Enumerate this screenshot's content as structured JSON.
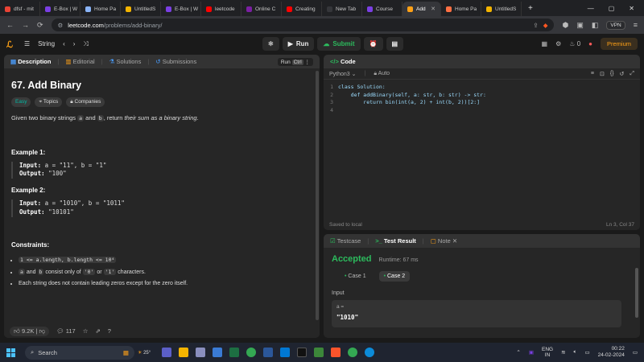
{
  "browser": {
    "tabs": [
      {
        "label": "dfsf - mit",
        "color": "#ea4335"
      },
      {
        "label": "E-Box | W",
        "color": "#7b3fe4"
      },
      {
        "label": "Home Pa",
        "color": "#8ab4f8"
      },
      {
        "label": "UntitledS",
        "color": "#f4b400"
      },
      {
        "label": "E-Box | W",
        "color": "#7b3fe4"
      },
      {
        "label": "leetcode",
        "color": "#ff0000"
      },
      {
        "label": "Online C",
        "color": "#7b1fa2"
      },
      {
        "label": "Creating",
        "color": "#ff0000"
      },
      {
        "label": "New Tab",
        "color": "#35363a"
      },
      {
        "label": "Course",
        "color": "#7b3fe4"
      },
      {
        "label": "Add",
        "color": "#ffa116",
        "active": true
      },
      {
        "label": "Home Pa",
        "color": "#ff7043"
      },
      {
        "label": "UntitledS",
        "color": "#f4b400"
      }
    ],
    "new_tab": "+",
    "url_host": "leetcode.com",
    "url_path": "/problems/add-binary/",
    "vpn": "VPN"
  },
  "lc_header": {
    "problem_list": "String",
    "run": "Run",
    "submit": "Submit",
    "streak": "0",
    "premium": "Premium"
  },
  "description": {
    "tabs": {
      "description": "Description",
      "editorial": "Editorial",
      "solutions": "Solutions",
      "submissions": "Submissions"
    },
    "run_btn": "Run",
    "run_shortcut": "Ctrl",
    "title": "67. Add Binary",
    "difficulty": "Easy",
    "topics": "Topics",
    "companies": "Companies",
    "intro_a": "Given two binary strings",
    "intro_var_a": "a",
    "intro_and": "and",
    "intro_var_b": "b",
    "intro_b": ", return",
    "intro_em": "their sum as a binary string",
    "intro_end": ".",
    "example1_title": "Example 1:",
    "example1_input_label": "Input:",
    "example1_input": "a = \"11\", b = \"1\"",
    "example1_output_label": "Output:",
    "example1_output": "\"100\"",
    "example2_title": "Example 2:",
    "example2_input_label": "Input:",
    "example2_input": "a = \"1010\", b = \"1011\"",
    "example2_output_label": "Output:",
    "example2_output": "\"10101\"",
    "constraints_title": "Constraints:",
    "constraint1": "1 <= a.length, b.length <= 10⁴",
    "constraint2_a": "a",
    "constraint2_and": "and",
    "constraint2_b": "b",
    "constraint2_mid": "consist only of",
    "constraint2_zero": "'0'",
    "constraint2_or": "or",
    "constraint2_one": "'1'",
    "constraint2_end": "characters.",
    "constraint3": "Each string does not contain leading zeros except for the zero itself.",
    "likes": "9.2K",
    "comments": "117"
  },
  "code": {
    "header": "Code",
    "language": "Python3",
    "auto": "Auto",
    "lines": [
      {
        "n": "1",
        "text": "class Solution:"
      },
      {
        "n": "2",
        "text": "    def addBinary(self, a: str, b: str) -> str:"
      },
      {
        "n": "3",
        "text": "        return bin(int(a, 2) + int(b, 2))[2:]"
      },
      {
        "n": "4",
        "text": ""
      }
    ],
    "saved": "Saved to local",
    "cursor": "Ln 3, Col 37"
  },
  "result": {
    "tab_testcase": "Testcase",
    "tab_result": "Test Result",
    "tab_note": "Note",
    "status": "Accepted",
    "runtime": "Runtime: 67 ms",
    "case1": "Case 1",
    "case2": "Case 2",
    "input_label": "Input",
    "var_label": "a =",
    "var_value": "\"1010\""
  },
  "taskbar": {
    "search": "Search",
    "weather": "25°",
    "lang_top": "ENG",
    "lang_bottom": "IN",
    "time": "00:22",
    "date": "24-02-2024"
  }
}
